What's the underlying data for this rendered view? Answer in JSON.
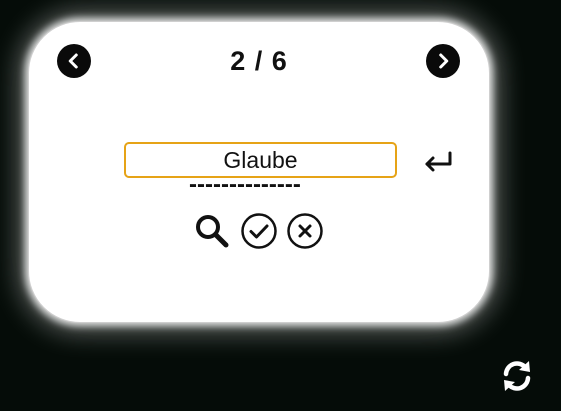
{
  "card": {
    "counter": "2 / 6",
    "answer_value": "Glaube",
    "hint_dashes": "--------------"
  },
  "icons": {
    "prev": "chevron-left-icon",
    "next": "chevron-right-icon",
    "enter": "enter-return-icon",
    "search": "search-icon",
    "check": "check-circle-icon",
    "cancel": "close-circle-icon",
    "refresh": "refresh-icon"
  },
  "colors": {
    "background": "#050c08",
    "card": "#ffffff",
    "input_border": "#e6a317",
    "icon": "#0a0a0a"
  }
}
